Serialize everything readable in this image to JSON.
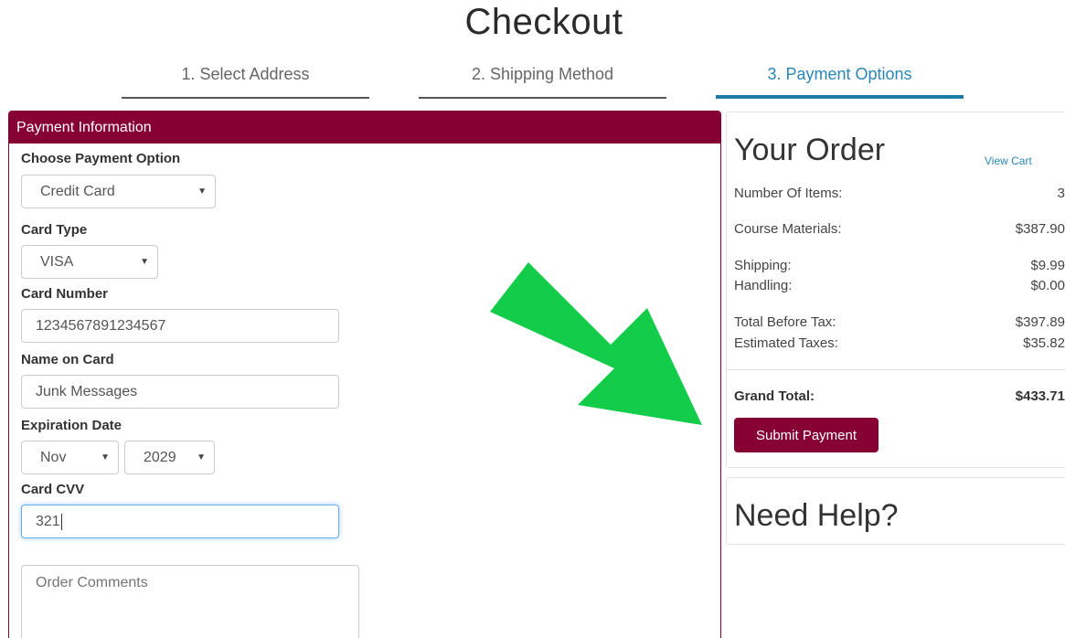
{
  "page": {
    "title": "Checkout"
  },
  "steps": [
    {
      "label": "1. Select Address"
    },
    {
      "label": "2. Shipping Method"
    },
    {
      "label": "3. Payment Options"
    }
  ],
  "payment": {
    "header": "Payment Information",
    "payment_option": {
      "label": "Choose Payment Option",
      "value": "Credit Card"
    },
    "card_type": {
      "label": "Card Type",
      "value": "VISA"
    },
    "card_number": {
      "label": "Card Number",
      "value": "1234567891234567"
    },
    "name_on_card": {
      "label": "Name on Card",
      "value": "Junk Messages"
    },
    "expiration": {
      "label": "Expiration Date",
      "month": "Nov",
      "year": "2029"
    },
    "cvv": {
      "label": "Card CVV",
      "value": "321"
    },
    "comments": {
      "placeholder": "Order Comments"
    }
  },
  "order": {
    "title": "Your Order",
    "view_cart": "View Cart",
    "items_label": "Number Of Items:",
    "items_value": "3",
    "materials_label": "Course Materials:",
    "materials_value": "$387.90",
    "shipping_label": "Shipping:",
    "shipping_value": "$9.99",
    "handling_label": "Handling:",
    "handling_value": "$0.00",
    "before_tax_label": "Total Before Tax:",
    "before_tax_value": "$397.89",
    "taxes_label": "Estimated Taxes:",
    "taxes_value": "$35.82",
    "grand_label": "Grand Total:",
    "grand_value": "$433.71",
    "submit_label": "Submit Payment"
  },
  "help": {
    "title": "Need Help?"
  },
  "colors": {
    "brand": "#870033",
    "active_step": "#2b86b8",
    "arrow": "#12cc4a"
  },
  "icons": {
    "select_caret": "caret-down-icon",
    "annotation": "green-arrow-icon"
  }
}
